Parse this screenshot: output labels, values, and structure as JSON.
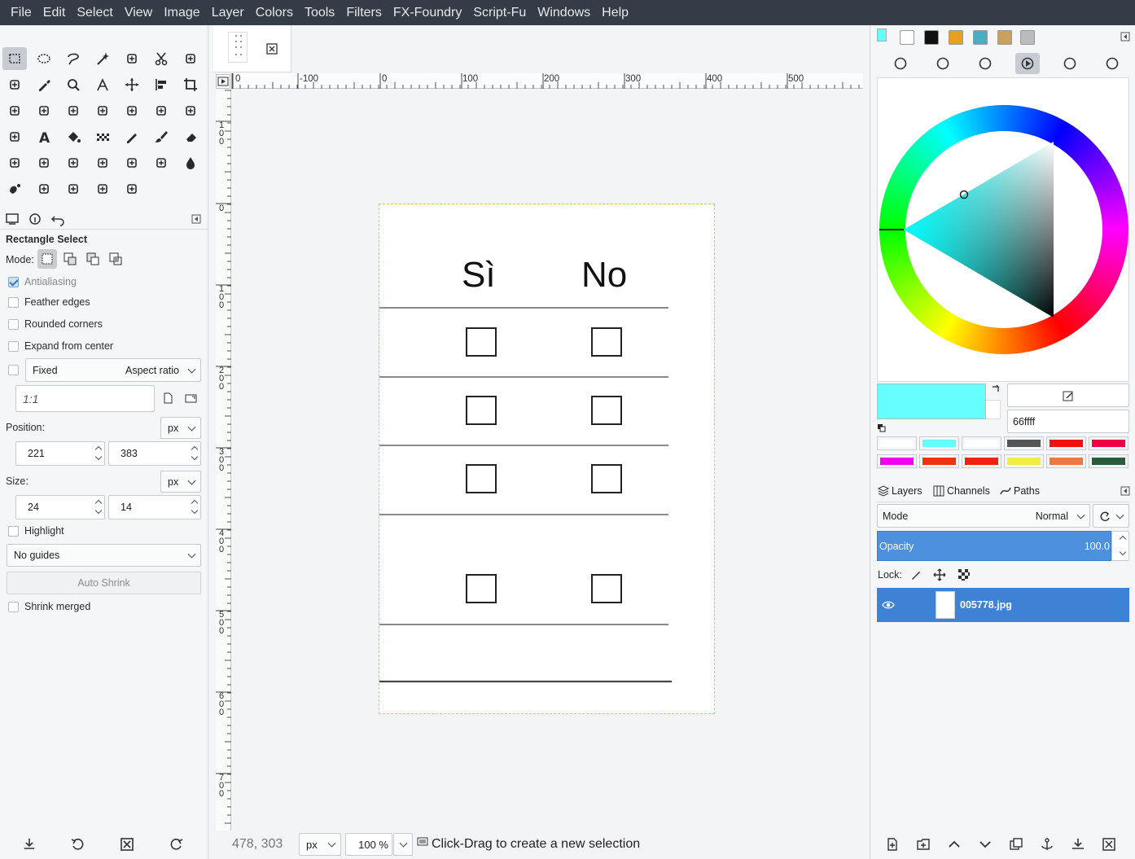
{
  "menubar": {
    "items": [
      "File",
      "Edit",
      "Select",
      "View",
      "Image",
      "Layer",
      "Colors",
      "Tools",
      "Filters",
      "FX-Foundry",
      "Script-Fu",
      "Windows",
      "Help"
    ]
  },
  "toolbox": {
    "icons": [
      "rect-select-icon",
      "ellipse-select-icon",
      "free-select-icon",
      "fuzzy-select-icon",
      "select-by-color-icon",
      "scissors-select-icon",
      "foreground-select-icon",
      "paths-icon",
      "color-picker-icon",
      "zoom-icon",
      "measure-icon",
      "move-icon",
      "align-icon",
      "crop-icon",
      "unified-transform-icon",
      "rotate-icon",
      "scale-icon",
      "shear-icon",
      "perspective-icon",
      "flip-icon",
      "cage-transform-icon",
      "warp-transform-icon",
      "text-icon",
      "bucket-fill-icon",
      "gradient-icon",
      "pencil-icon",
      "paintbrush-icon",
      "eraser-icon",
      "airbrush-icon",
      "ink-icon",
      "mypaint-brush-icon",
      "clone-icon",
      "heal-icon",
      "perspective-clone-icon",
      "blur-sharpen-icon",
      "smudge-icon",
      "dodge-burn-icon",
      "gegl-icon",
      "seamless-clone-icon",
      "handle-transform-icon"
    ]
  },
  "tool_options": {
    "title": "Rectangle Select",
    "mode_label": "Mode:",
    "antialiasing": "Antialiasing",
    "feather_edges": "Feather edges",
    "rounded_corners": "Rounded corners",
    "expand_from_center": "Expand from center",
    "fixed": "Fixed",
    "fixed_option": "Aspect ratio",
    "ratio_value": "1:1",
    "position_label": "Position:",
    "position_unit": "px",
    "position_x": "221",
    "position_y": "383",
    "size_label": "Size:",
    "size_unit": "px",
    "size_w": "24",
    "size_h": "14",
    "highlight": "Highlight",
    "guides": "No guides",
    "auto_shrink": "Auto Shrink",
    "shrink_merged": "Shrink merged"
  },
  "rulers": {
    "h_ticks": [
      "0",
      "-100",
      "0",
      "100",
      "200",
      "300",
      "400",
      "500"
    ],
    "v_ticks": [
      "100",
      "0",
      "100",
      "200",
      "300",
      "400",
      "500",
      "600",
      "700"
    ]
  },
  "document": {
    "col_si": "Sì",
    "col_no": "No"
  },
  "statusbar": {
    "coords": "478, 303",
    "unit": "px",
    "zoom": "100 %",
    "message": "Click-Drag to create a new selection"
  },
  "colors": {
    "foreground": "#66ffff",
    "hex_value": "66ffff",
    "history": [
      "#ffffff",
      "#66ffff",
      "#ffffff",
      "#555555",
      "#ee1111",
      "#ee0044",
      "#ee00ee",
      "#ee3311",
      "#ee2211",
      "#eeee44",
      "#ee7744",
      "#2d5a3a"
    ]
  },
  "layers": {
    "tabs": [
      "Layers",
      "Channels",
      "Paths"
    ],
    "mode_label": "Mode",
    "mode_value": "Normal",
    "opacity_label": "Opacity",
    "opacity_value": "100.0",
    "lock_label": "Lock:",
    "layer_name": "005778.jpg"
  }
}
